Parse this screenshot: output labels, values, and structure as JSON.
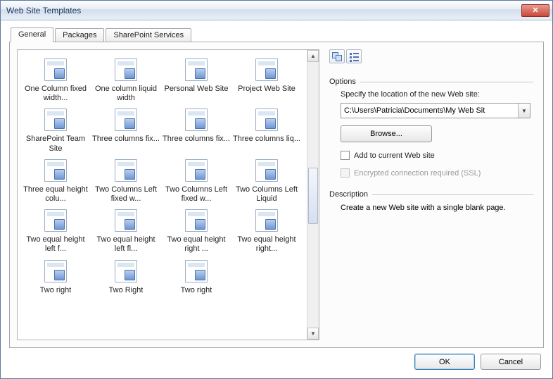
{
  "window": {
    "title": "Web Site Templates"
  },
  "tabs": [
    {
      "label": "General",
      "active": true
    },
    {
      "label": "Packages",
      "active": false
    },
    {
      "label": "SharePoint Services",
      "active": false
    }
  ],
  "templates": [
    {
      "label": "One Column fixed width..."
    },
    {
      "label": "One column liquid width"
    },
    {
      "label": "Personal Web Site"
    },
    {
      "label": "Project Web Site"
    },
    {
      "label": "SharePoint Team Site"
    },
    {
      "label": "Three columns fix..."
    },
    {
      "label": "Three columns fix..."
    },
    {
      "label": "Three columns liq..."
    },
    {
      "label": "Three equal height colu..."
    },
    {
      "label": "Two Columns Left fixed w..."
    },
    {
      "label": "Two Columns Left fixed w..."
    },
    {
      "label": "Two Columns Left Liquid"
    },
    {
      "label": "Two equal height left f..."
    },
    {
      "label": "Two equal height left fl..."
    },
    {
      "label": "Two equal height right ..."
    },
    {
      "label": "Two equal height right..."
    },
    {
      "label": "Two right"
    },
    {
      "label": "Two Right"
    },
    {
      "label": "Two right"
    }
  ],
  "options": {
    "heading": "Options",
    "location_label": "Specify the location of the new Web site:",
    "location_value": "C:\\Users\\Patricia\\Documents\\My Web Sit",
    "browse_label": "Browse...",
    "add_to_current_label": "Add to current Web site",
    "ssl_label": "Encrypted connection required (SSL)"
  },
  "description": {
    "heading": "Description",
    "text": "Create a new Web site with a single blank page."
  },
  "footer": {
    "ok_label": "OK",
    "cancel_label": "Cancel"
  }
}
